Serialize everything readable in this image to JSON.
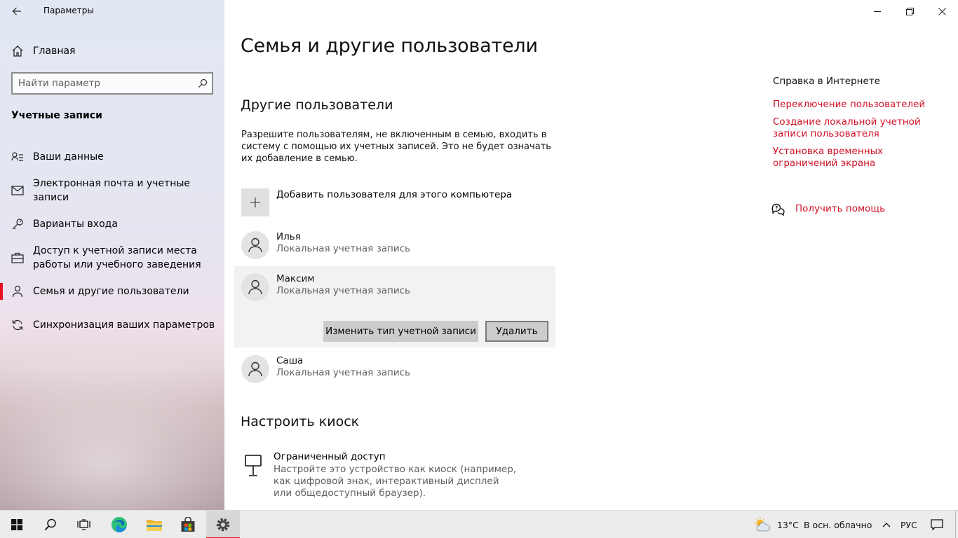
{
  "window": {
    "title": "Параметры"
  },
  "sidebar": {
    "home_label": "Главная",
    "search_placeholder": "Найти параметр",
    "section_title": "Учетные записи",
    "items": [
      {
        "label": "Ваши данные",
        "icon": "person-card-icon"
      },
      {
        "label": "Электронная почта и учетные записи",
        "icon": "mail-icon"
      },
      {
        "label": "Варианты входа",
        "icon": "key-icon"
      },
      {
        "label": "Доступ к учетной записи места работы или учебного заведения",
        "icon": "briefcase-icon"
      },
      {
        "label": "Семья и другие пользователи",
        "icon": "family-icon",
        "active": true
      },
      {
        "label": "Синхронизация ваших параметров",
        "icon": "sync-icon"
      }
    ]
  },
  "main": {
    "page_title": "Семья и другие пользователи",
    "other_users": {
      "title": "Другие пользователи",
      "description": "Разрешите пользователям, не включенным в семью, входить в систему с помощью их учетных записей. Это не будет означать их добавление в семью.",
      "add_user_label": "Добавить пользователя для этого компьютера",
      "users": [
        {
          "name": "Илья",
          "type": "Локальная учетная запись"
        },
        {
          "name": "Максим",
          "type": "Локальная учетная запись",
          "expanded": true
        },
        {
          "name": "Саша",
          "type": "Локальная учетная запись"
        }
      ],
      "change_type_label": "Изменить тип учетной записи",
      "delete_label": "Удалить"
    },
    "kiosk": {
      "title": "Настроить киоск",
      "item_title": "Ограниченный доступ",
      "item_description": "Настройте это устройство как киоск (например, как цифровой знак, интерактивный дисплей или общедоступный браузер)."
    }
  },
  "help": {
    "title": "Справка в Интернете",
    "links": [
      "Переключение пользователей",
      "Создание локальной учетной записи пользователя",
      "Установка временных ограничений экрана"
    ],
    "get_help_label": "Получить помощь"
  },
  "taskbar": {
    "weather_temp": "13°C",
    "weather_text": "В осн. облачно",
    "language": "РУС"
  },
  "colors": {
    "accent": "#e81123",
    "link": "#d01126"
  }
}
